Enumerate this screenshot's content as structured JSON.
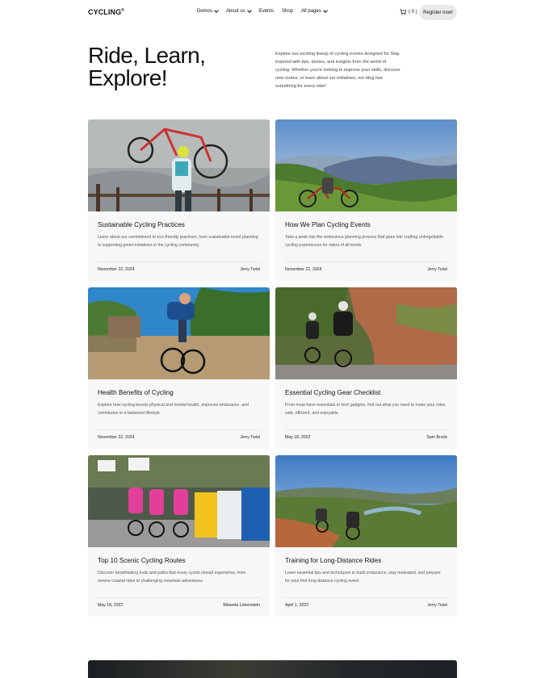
{
  "header": {
    "logo": "CYCLING",
    "logo_mark": "®",
    "nav": [
      {
        "label": "Demos",
        "dropdown": true
      },
      {
        "label": "About us",
        "dropdown": true
      },
      {
        "label": "Events",
        "dropdown": false
      },
      {
        "label": "Shop",
        "dropdown": false
      },
      {
        "label": "All pages",
        "dropdown": true
      }
    ],
    "cart_count": "( 0 )",
    "register_label": "Register now!"
  },
  "hero": {
    "title": "Ride, Learn, Explore!",
    "description": "Explore our exciting lineup of cycling events designed for Stay inspired with tips, stories, and insights from the world of cycling. Whether you're looking to improve your skills, discover new routes, or learn about our initiatives, our blog has something for every rider!"
  },
  "posts": [
    {
      "title": "Sustainable Cycling Practices",
      "excerpt": "Learn about our commitment to eco-friendly practices, from sustainable event planning to supporting green initiatives in the cycling community.",
      "date": "November 22, 2024",
      "author": "Jerry Twist"
    },
    {
      "title": "How We Plan Cycling Events",
      "excerpt": "Take a peek into the meticulous planning process that goes into crafting unforgettable cycling experiences for riders of all levels.",
      "date": "November 22, 2024",
      "author": "Jerry Twist"
    },
    {
      "title": "Health Benefits of Cycling",
      "excerpt": "Explore how cycling boosts physical and mental health, improves endurance, and contributes to a balanced lifestyle.",
      "date": "November 22, 2024",
      "author": "Jerry Twist"
    },
    {
      "title": "Essential Cycling Gear Checklist",
      "excerpt": "From must-have essentials to tech gadgets, find out what you need to make your rides safe, efficient, and enjoyable.",
      "date": "May 18, 2022",
      "author": "Sam Brook"
    },
    {
      "title": "Top 10 Scenic Cycling Routes",
      "excerpt": "Discover breathtaking trails and paths that every cyclist should experience, from serene coastal rides to challenging mountain adventures.",
      "date": "May 18, 2022",
      "author": "Miranda Lebenstein"
    },
    {
      "title": "Training for Long-Distance Rides",
      "excerpt": "Learn essential tips and techniques to build endurance, stay motivated, and prepare for your first long-distance cycling event.",
      "date": "April 1, 2022",
      "author": "Jerry Twist"
    }
  ],
  "colors": {
    "card_bg": "#f7f7f8",
    "button_bg": "#e9e9ea",
    "text": "#111111"
  }
}
